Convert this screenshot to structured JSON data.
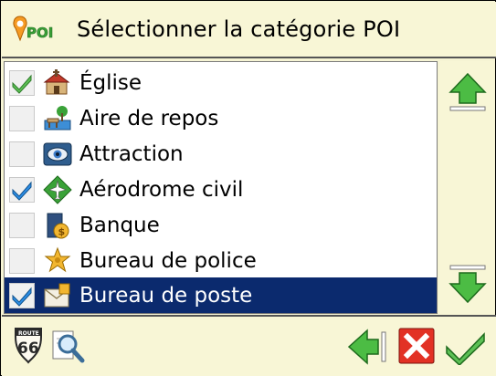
{
  "header": {
    "title": "Sélectionner la catégorie POI",
    "logo_text": "POI"
  },
  "categories": [
    {
      "label": "Église",
      "checked": true,
      "selected": false,
      "icon": "church-icon"
    },
    {
      "label": "Aire de repos",
      "checked": false,
      "selected": false,
      "icon": "rest-area-icon"
    },
    {
      "label": "Attraction",
      "checked": false,
      "selected": false,
      "icon": "attraction-icon"
    },
    {
      "label": "Aérodrome civil",
      "checked": true,
      "selected": false,
      "icon": "airfield-icon"
    },
    {
      "label": "Banque",
      "checked": false,
      "selected": false,
      "icon": "bank-icon"
    },
    {
      "label": "Bureau de police",
      "checked": false,
      "selected": false,
      "icon": "police-icon"
    },
    {
      "label": "Bureau de poste",
      "checked": true,
      "selected": true,
      "icon": "post-office-icon"
    }
  ],
  "toolbar": {
    "route_sign_top": "ROUTE",
    "route_sign_number": "66"
  },
  "colors": {
    "selection": "#0b2a6e",
    "panel": "#f8f6d6",
    "check_green": "#4cb848",
    "check_blue": "#1e6fd9",
    "arrow_green": "#3fae3a",
    "cancel_red": "#e23124"
  }
}
